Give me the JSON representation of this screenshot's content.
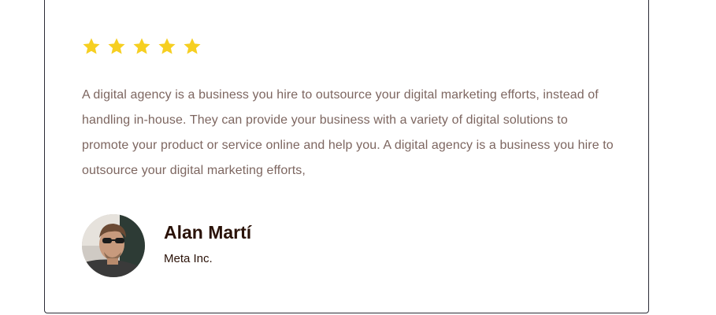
{
  "testimonial": {
    "rating": 5,
    "rating_max": 5,
    "star_color": "#f6cf21",
    "star_icon": "star-icon",
    "text": "A digital agency is a business you hire to outsource your digital marketing efforts, instead of handling in-house. They can provide your business with a variety of digital solutions to promote your product or service online and help you. A digital agency is a business you hire to outsource your digital marketing efforts,",
    "author": {
      "name": "Alan Martí",
      "company": "Meta Inc.",
      "avatar_icon": "avatar-photo"
    }
  },
  "colors": {
    "border": "#2b2b36",
    "quote_text": "#7d6660",
    "name_text": "#2a1208"
  }
}
